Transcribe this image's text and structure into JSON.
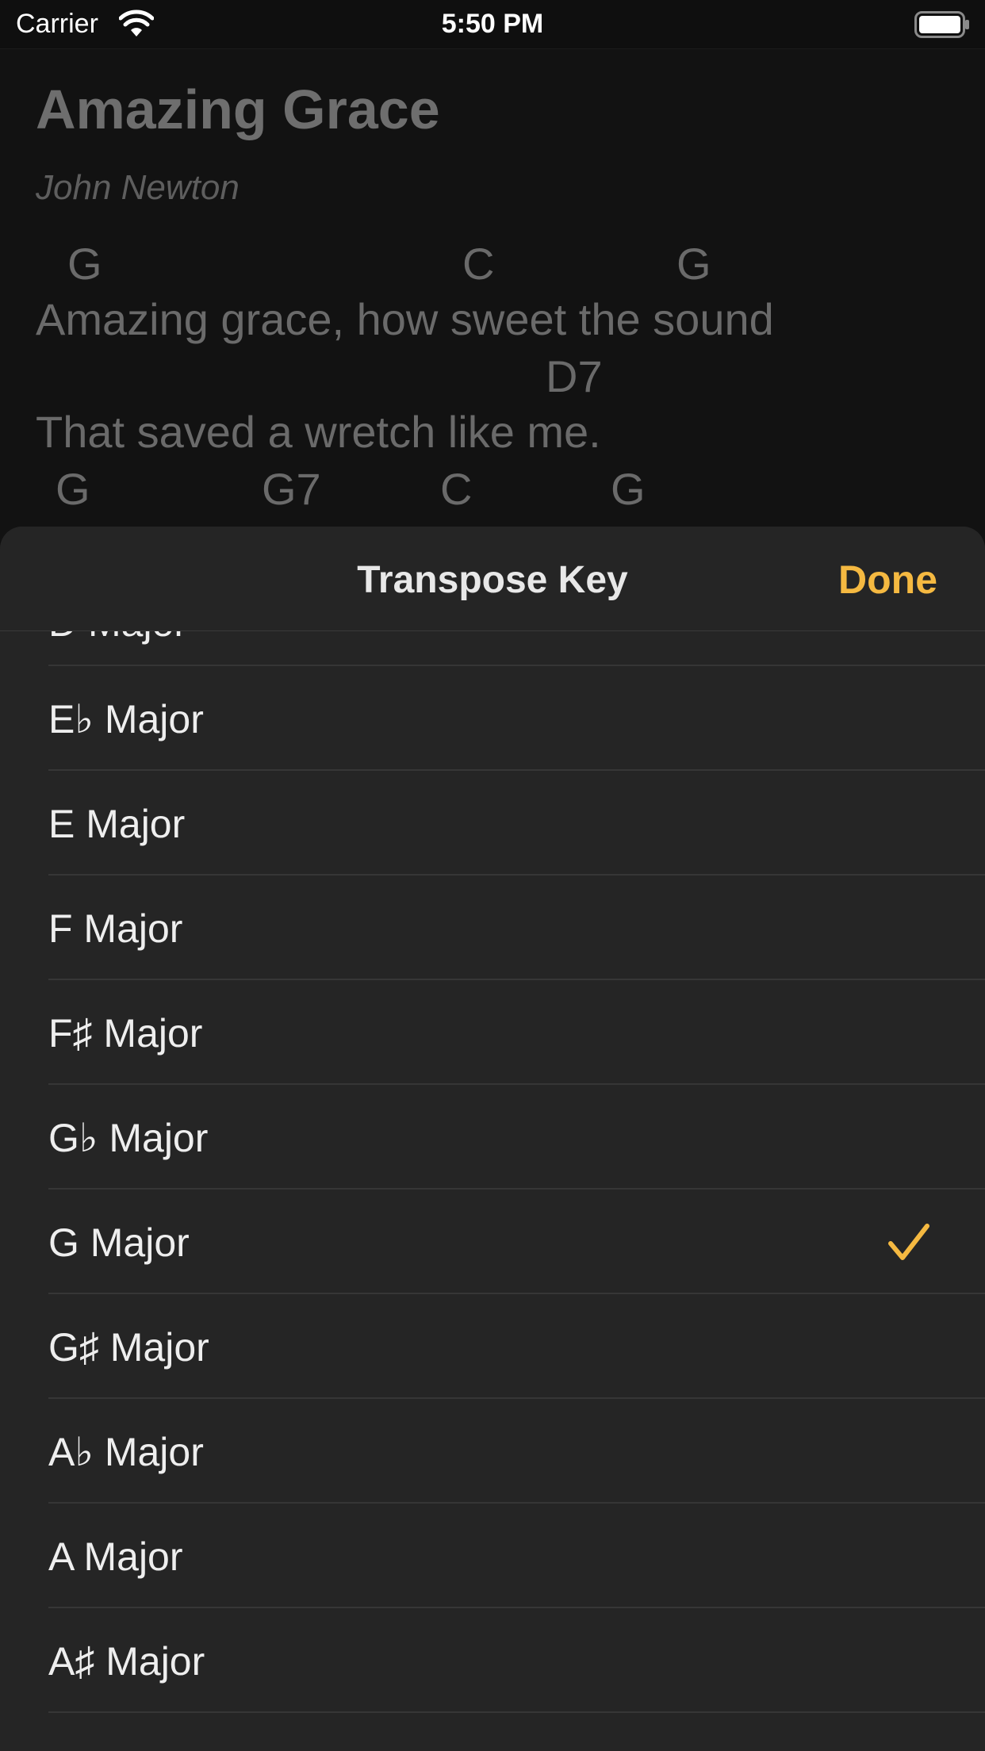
{
  "status_bar": {
    "carrier": "Carrier",
    "time": "5:50 PM",
    "wifi_icon": "wifi-icon",
    "battery_icon": "battery-icon"
  },
  "song": {
    "title": "Amazing Grace",
    "author": "John Newton",
    "lines": [
      {
        "chords": [
          "G",
          "C",
          "G"
        ],
        "lyric": "Amazing grace, how sweet the sound"
      },
      {
        "chords": [
          "D7"
        ],
        "lyric": "That saved a wretch like me."
      },
      {
        "chords": [
          "G",
          "G7",
          "C",
          "G"
        ],
        "lyric": ""
      }
    ]
  },
  "sheet": {
    "title": "Transpose Key",
    "done_label": "Done",
    "partial_item": "D Major",
    "keys": [
      {
        "label": "E♭ Major",
        "selected": false
      },
      {
        "label": "E Major",
        "selected": false
      },
      {
        "label": "F Major",
        "selected": false
      },
      {
        "label": "F♯ Major",
        "selected": false
      },
      {
        "label": "G♭ Major",
        "selected": false
      },
      {
        "label": "G Major",
        "selected": true
      },
      {
        "label": "G♯ Major",
        "selected": false
      },
      {
        "label": "A♭ Major",
        "selected": false
      },
      {
        "label": "A Major",
        "selected": false
      },
      {
        "label": "A♯ Major",
        "selected": false
      }
    ],
    "checkmark_icon": "checkmark-icon"
  },
  "colors": {
    "accent": "#f5b941",
    "background": "#121212",
    "sheet": "#252525"
  }
}
